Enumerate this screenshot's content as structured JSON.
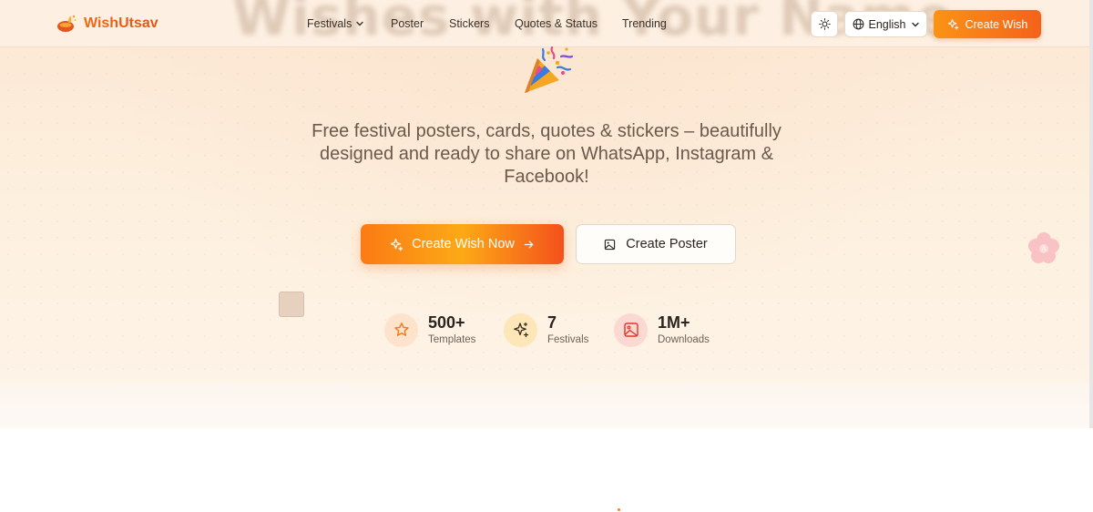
{
  "header": {
    "background_heading": "Wishes with Your Name",
    "logo_text": "WishUtsav",
    "nav": [
      {
        "label": "Festivals",
        "has_dropdown": true
      },
      {
        "label": "Poster"
      },
      {
        "label": "Stickers"
      },
      {
        "label": "Quotes & Status"
      },
      {
        "label": "Trending"
      }
    ],
    "theme_toggle_icon": "sun-icon",
    "language_label": "English",
    "cta_label": "Create Wish"
  },
  "hero": {
    "emoji_icon": "party-popper-icon",
    "tagline": "Free festival posters, cards, quotes & stickers – beautifully designed and ready to share on WhatsApp, Instagram & Facebook!",
    "primary_button_label": "Create Wish Now",
    "secondary_button_label": "Create Poster",
    "stats": [
      {
        "value": "500+",
        "label": "Templates",
        "icon": "star-icon"
      },
      {
        "value": "7",
        "label": "Festivals",
        "icon": "sparkles-icon"
      },
      {
        "value": "1M+",
        "label": "Downloads",
        "icon": "image-icon"
      }
    ]
  },
  "colors": {
    "brand_orange": "#f4621a",
    "brand_amber": "#fb9316",
    "hero_bg": "#fce7d3",
    "text_dark": "#2a2420",
    "text_muted": "#6b5a4c"
  }
}
